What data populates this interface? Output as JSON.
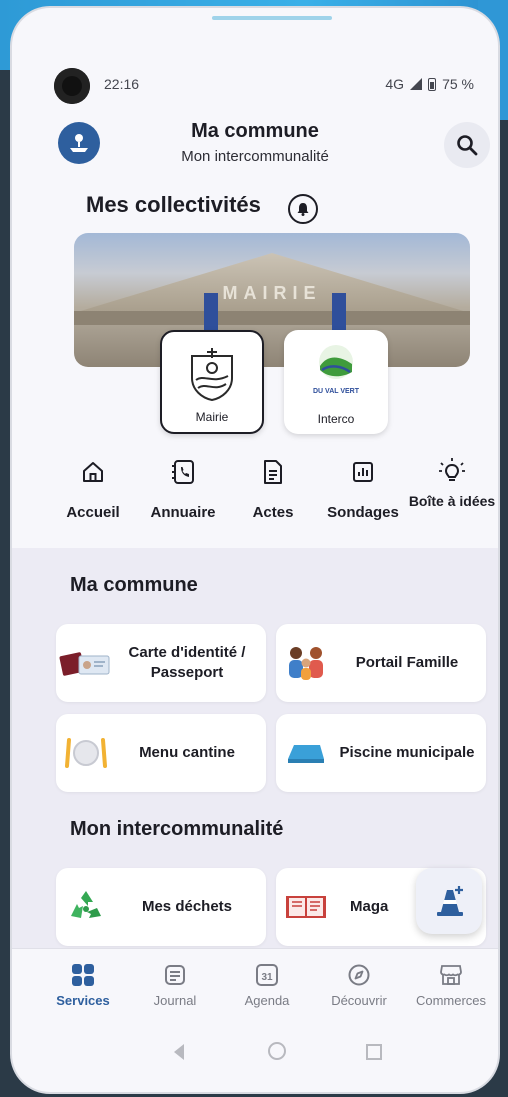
{
  "statusbar": {
    "time": "22:16",
    "network": "4G",
    "battery": "75 %"
  },
  "header": {
    "title": "Ma commune",
    "subtitle": "Mon intercommunalité"
  },
  "collectivites": {
    "title": "Mes collectivités",
    "banner_text": "MAIRIE",
    "cards": [
      {
        "label": "Mairie",
        "selected": true
      },
      {
        "label": "Interco",
        "selected": false,
        "logo_text": "DU VAL VERT"
      }
    ]
  },
  "quicknav": [
    {
      "label": "Accueil",
      "icon": "home-icon"
    },
    {
      "label": "Annuaire",
      "icon": "phone-book-icon"
    },
    {
      "label": "Actes",
      "icon": "document-icon"
    },
    {
      "label": "Sondages",
      "icon": "poll-chart-icon"
    },
    {
      "label": "Boîte à idées",
      "icon": "lightbulb-icon"
    }
  ],
  "sections": [
    {
      "title": "Ma commune",
      "tiles": [
        {
          "label": "Carte d'identité / Passeport",
          "icon": "id-card-icon"
        },
        {
          "label": "Portail Famille",
          "icon": "family-icon"
        },
        {
          "label": "Menu cantine",
          "icon": "cutlery-plate-icon"
        },
        {
          "label": "Piscine municipale",
          "icon": "pool-icon"
        }
      ]
    },
    {
      "title": "Mon intercommunalité",
      "tiles": [
        {
          "label": "Mes déchets",
          "icon": "recycle-icon"
        },
        {
          "label": "Maga",
          "icon": "magazine-icon"
        }
      ]
    }
  ],
  "tabs": [
    {
      "label": "Services",
      "icon": "grid-icon",
      "active": true
    },
    {
      "label": "Journal",
      "icon": "journal-icon",
      "active": false
    },
    {
      "label": "Agenda",
      "icon": "calendar-icon",
      "active": false,
      "badge": "31"
    },
    {
      "label": "Découvrir",
      "icon": "compass-icon",
      "active": false
    },
    {
      "label": "Commerces",
      "icon": "shop-icon",
      "active": false
    }
  ],
  "colors": {
    "primary": "#2e5f9e",
    "section_bg": "#ecebf4",
    "accent_top": "#2e9ad6"
  }
}
